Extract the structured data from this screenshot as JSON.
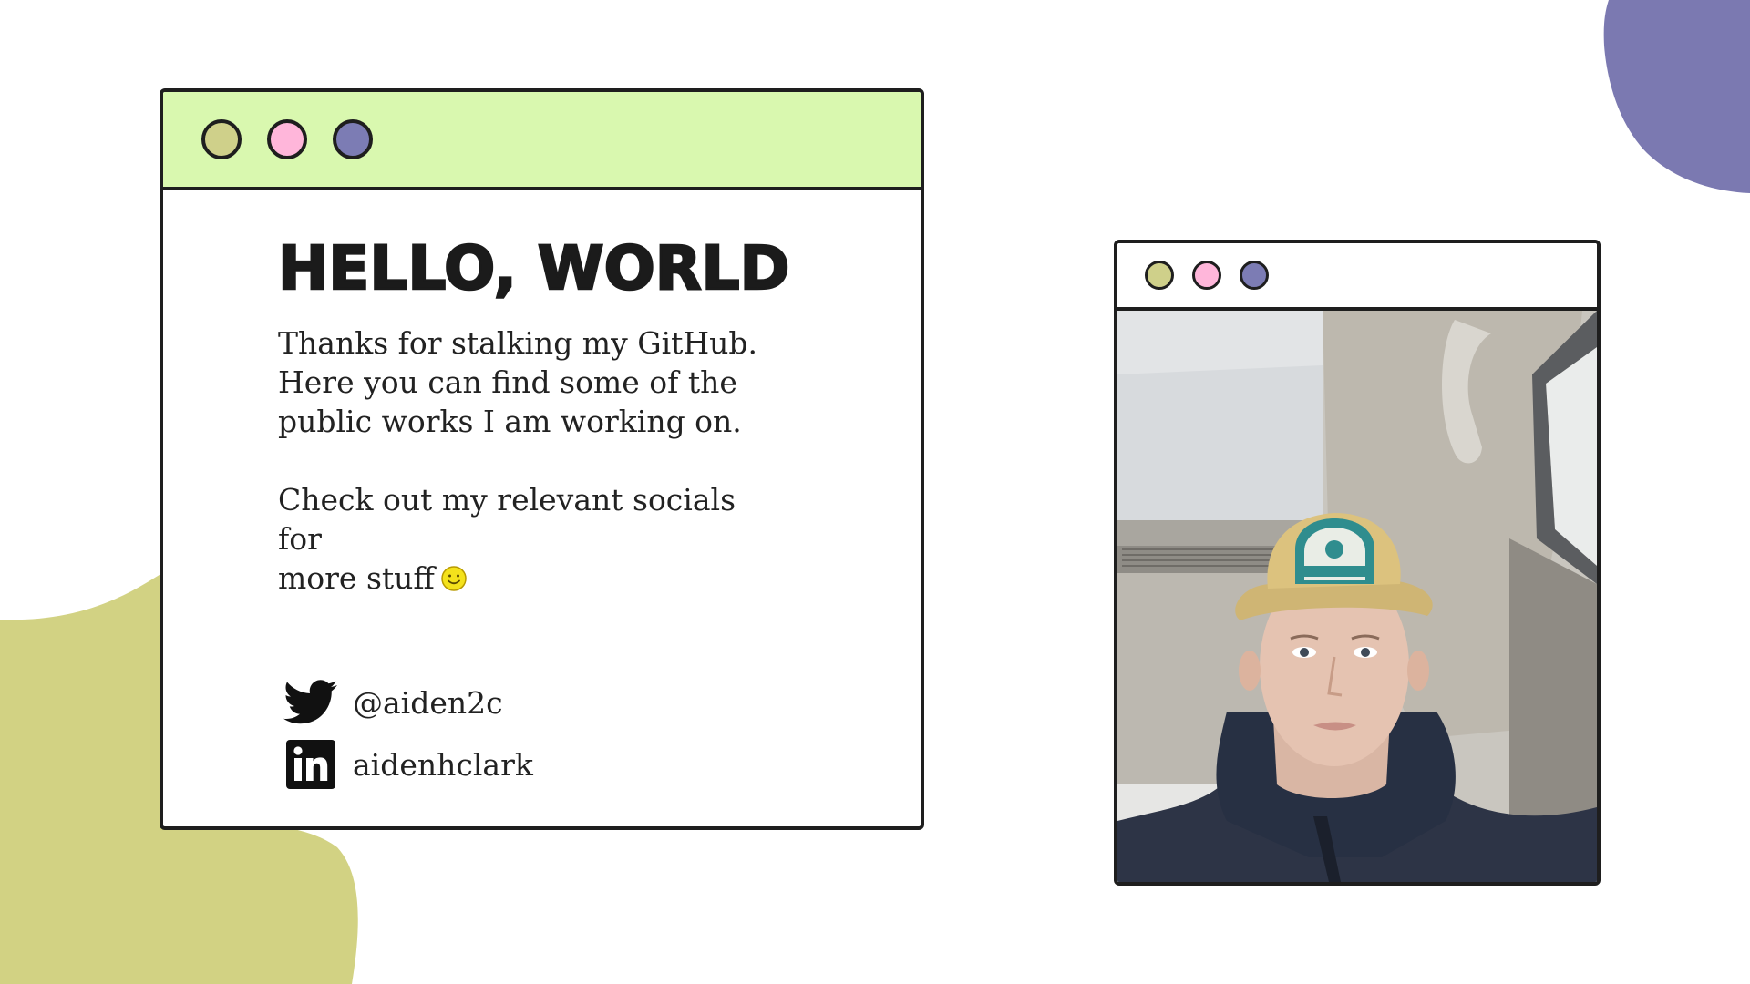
{
  "colors": {
    "titlebar_green": "#d9f8af",
    "dot_olive": "#cfd08a",
    "dot_pink": "#ffb6da",
    "dot_purple": "#7c7cb4",
    "blob_olive": "#d2d283",
    "blob_purple": "#7b79b1",
    "outline": "#1e1e1e"
  },
  "card": {
    "title": "HELLO, WORLD",
    "intro_lines": [
      "Thanks for stalking my GitHub.",
      "Here you can find some of the",
      "public works I am working on."
    ],
    "socials_lines": [
      "Check out my relevant socials for",
      "more stuff"
    ],
    "emoji_icon": "smiley-face-icon",
    "socials": [
      {
        "icon": "twitter-bird-icon",
        "handle": "@aiden2c"
      },
      {
        "icon": "linkedin-icon",
        "handle": "aidenhclark"
      }
    ]
  },
  "photo_window": {
    "image_subject": "selfie of person in tan Patagonia cap and navy puffer jacket inside a car"
  }
}
